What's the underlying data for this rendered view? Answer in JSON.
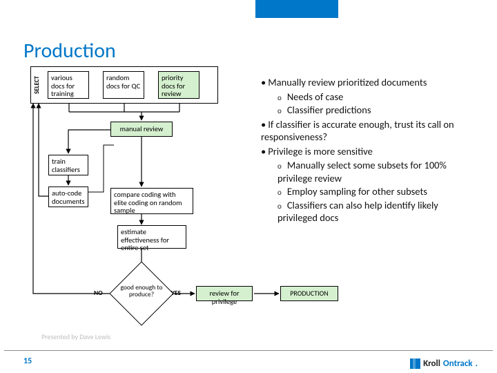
{
  "title": "Production",
  "slide_number": "15",
  "presented_by": "Presented by Dave Lewis",
  "brand": {
    "left": "Kroll",
    "right": "Ontrack"
  },
  "select_label": "SELECT",
  "boxes": {
    "training": "various docs for training",
    "random_qc": "random docs for QC",
    "priority": "priority docs for review",
    "manual_review": "manual review",
    "train_classifiers": "train classifiers",
    "auto_code": "auto-code documents",
    "compare": "compare coding with elite coding on random sample",
    "estimate": "estimate effectiveness for entire set",
    "decision": "good enough to produce?",
    "review_privilege": "review for privilege",
    "production": "PRODUCTION"
  },
  "decision_labels": {
    "no": "NO",
    "yes": "YES"
  },
  "bullets": [
    {
      "text": "Manually review prioritized documents",
      "sub": [
        "Needs of case",
        "Classifier predictions"
      ]
    },
    {
      "text": "If classifier is accurate enough, trust its call on responsiveness?"
    },
    {
      "text": "Privilege is more sensitive",
      "sub": [
        "Manually select some subsets for 100% privilege review",
        "Employ sampling for other subsets",
        "Classifiers can also help identify likely privileged docs"
      ]
    }
  ]
}
